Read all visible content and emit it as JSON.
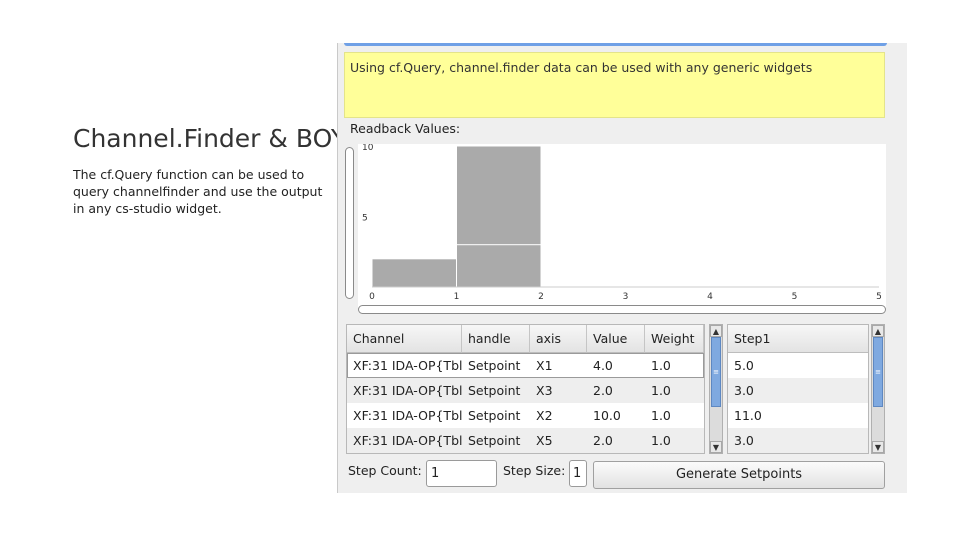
{
  "slide": {
    "title": "Channel.Finder & BOY",
    "body": "The cf.Query function can be used to query channelfinder and use the output in any cs-studio widget."
  },
  "panel": {
    "note": "Using cf.Query, channel.finder data can be used with any generic widgets",
    "readback_label": "Readback Values:"
  },
  "chart_data": {
    "type": "bar",
    "x_ticks": [
      "0",
      "1",
      "2",
      "3",
      "4",
      "5",
      "5"
    ],
    "y_ticks": [
      "10",
      "5"
    ],
    "bars": [
      {
        "x0": 0,
        "x1": 1,
        "value": 2
      },
      {
        "x0": 1,
        "x1": 2,
        "value": 10
      },
      {
        "x0": 1,
        "x1": 2,
        "value": 3
      }
    ],
    "xlim": [
      0,
      6
    ],
    "ylim": [
      0,
      10
    ],
    "grid": false,
    "bar_color": "#aaaaaa"
  },
  "table": {
    "columns": [
      "Channel",
      "handle",
      "axis",
      "Value",
      "Weight"
    ],
    "rows": [
      [
        "XF:31 IDA-OP{Tbl",
        "Setpoint",
        "X1",
        "4.0",
        "1.0"
      ],
      [
        "XF:31 IDA-OP{Tbl",
        "Setpoint",
        "X3",
        "2.0",
        "1.0"
      ],
      [
        "XF:31 IDA-OP{Tbl",
        "Setpoint",
        "X2",
        "10.0",
        "1.0"
      ],
      [
        "XF:31 IDA-OP{Tbl",
        "Setpoint",
        "X5",
        "2.0",
        "1.0"
      ]
    ],
    "scroll_up_icon": "▲",
    "scroll_down_icon": "▼",
    "grip_icon": "≡"
  },
  "steps": {
    "column": "Step1",
    "values": [
      "5.0",
      "3.0",
      "11.0",
      "3.0"
    ]
  },
  "controls": {
    "step_count_label": "Step Count:",
    "step_count_value": "1",
    "step_size_label": "Step Size:",
    "step_size_value": "1",
    "generate_label": "Generate Setpoints"
  },
  "colors": {
    "note_bg": "#ffff99",
    "accent": "#6fa0e6",
    "scroll_thumb": "#7fa9e0"
  }
}
